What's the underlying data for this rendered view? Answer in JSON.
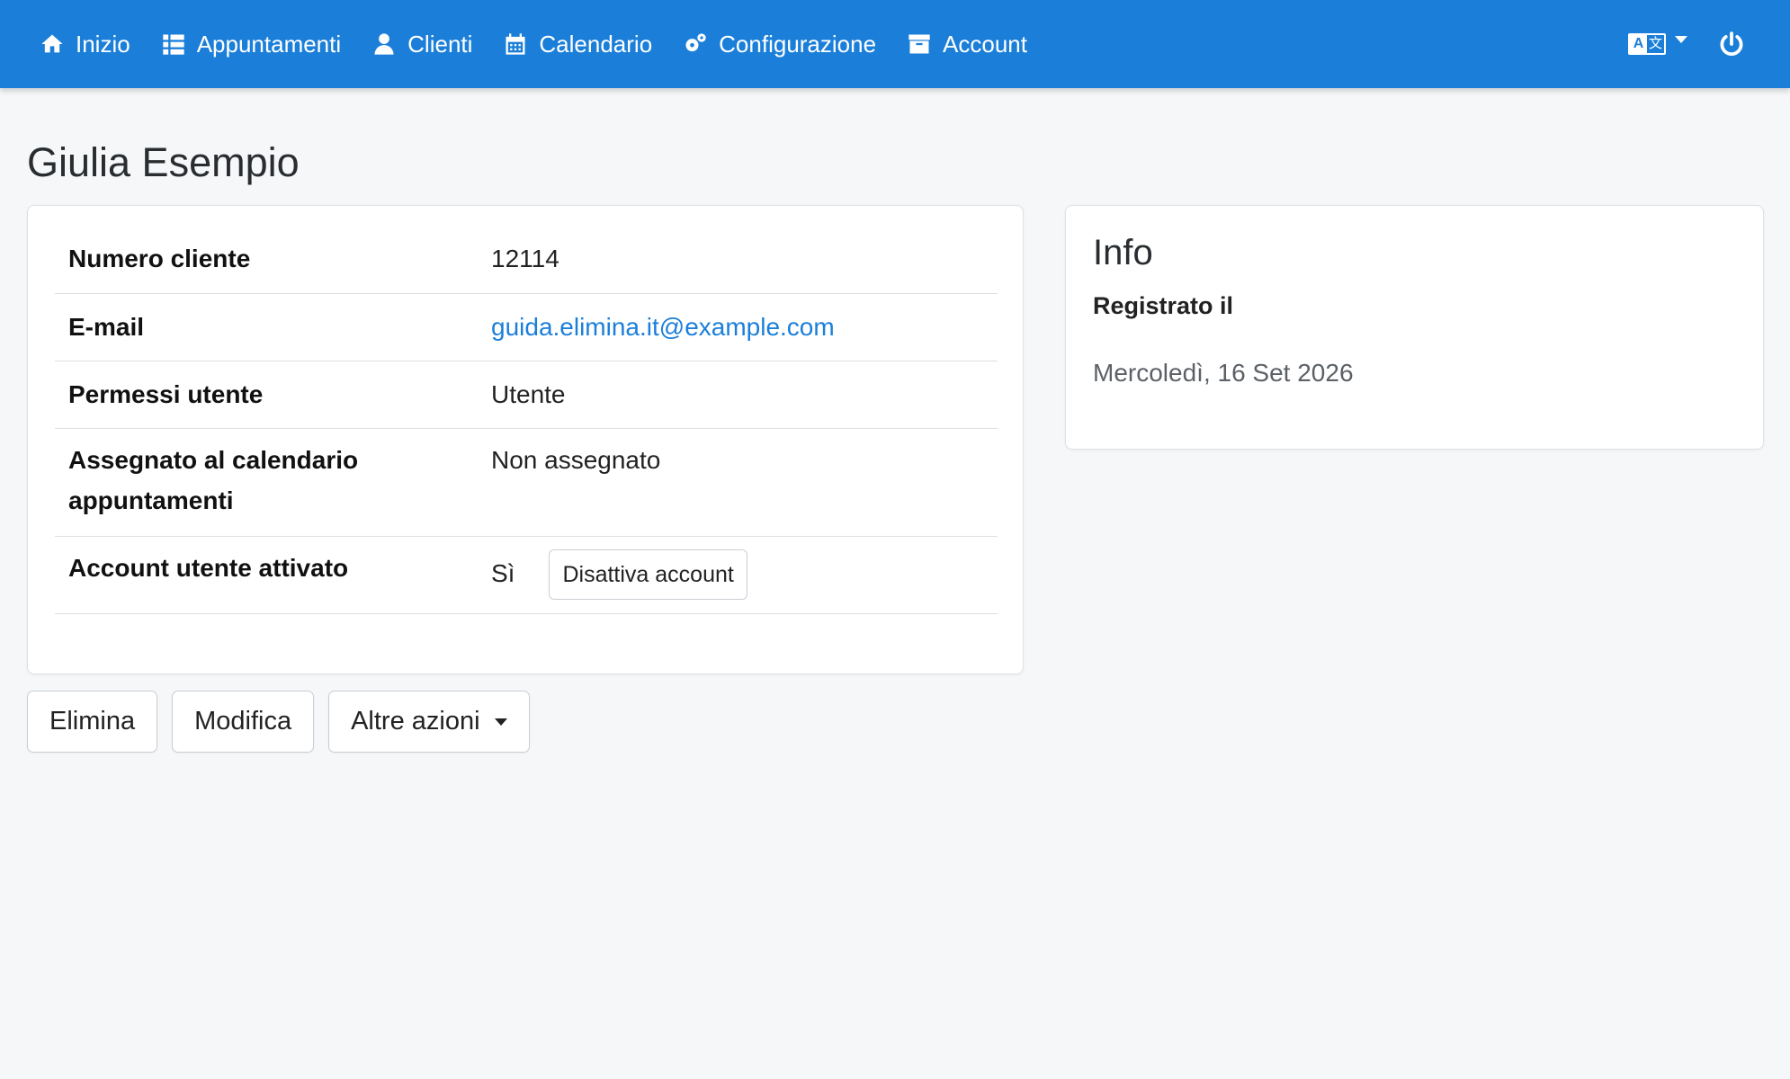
{
  "nav": {
    "items": [
      {
        "label": "Inizio",
        "icon": "home-icon"
      },
      {
        "label": "Appuntamenti",
        "icon": "list-icon"
      },
      {
        "label": "Clienti",
        "icon": "user-icon"
      },
      {
        "label": "Calendario",
        "icon": "calendar-icon"
      },
      {
        "label": "Configurazione",
        "icon": "cogs-icon"
      },
      {
        "label": "Account",
        "icon": "archive-icon"
      }
    ],
    "language_icon": "language-icon",
    "logout_icon": "power-icon",
    "background": "#1b7fd9"
  },
  "page": {
    "title": "Giulia Esempio"
  },
  "details": {
    "rows": [
      {
        "label": "Numero cliente",
        "value": "12114"
      },
      {
        "label": "E-mail",
        "value": "guida.elimina.it@example.com"
      },
      {
        "label": "Permessi utente",
        "value": "Utente"
      },
      {
        "label": "Assegnato al calendario appuntamenti",
        "value": "Non assegnato"
      },
      {
        "label": "Account utente attivato",
        "value": "Sì",
        "button": "Disattiva account"
      }
    ]
  },
  "info": {
    "title": "Info",
    "registered_label": "Registrato il",
    "registered_value": "Mercoledì, 16 Set 2026"
  },
  "actions": {
    "delete": "Elimina",
    "edit": "Modifica",
    "more": "Altre azioni"
  },
  "colors": {
    "link": "#1b7fd9"
  }
}
